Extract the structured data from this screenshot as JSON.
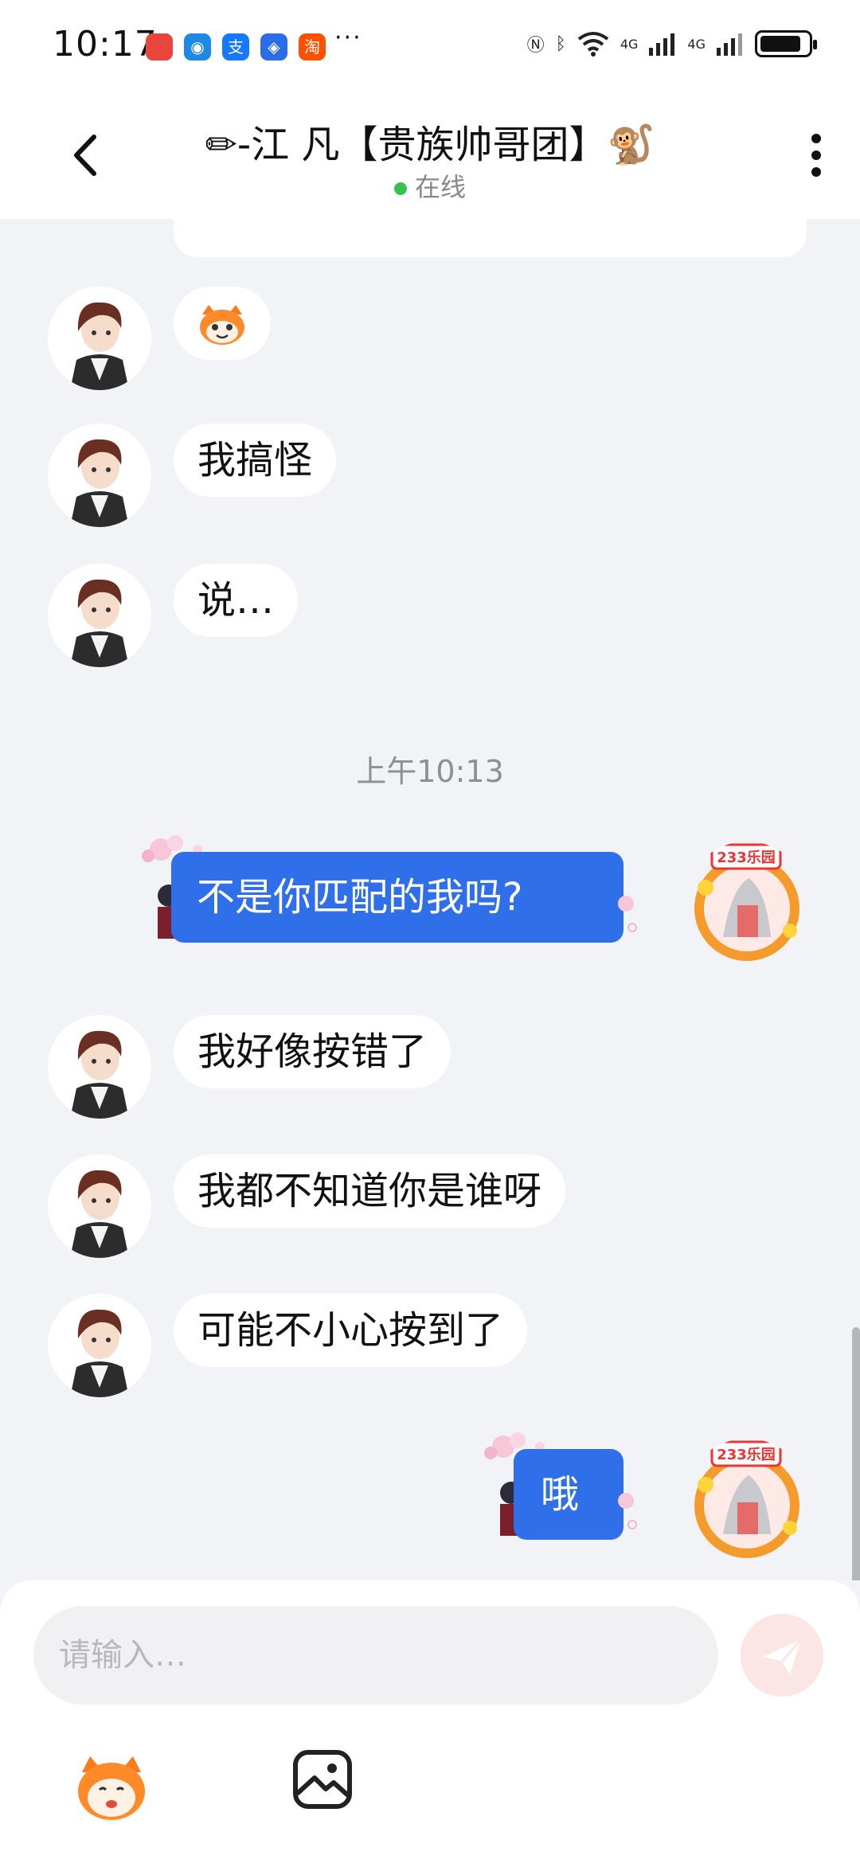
{
  "status_bar": {
    "time": "10:17",
    "more": "···",
    "network_1": "4G",
    "network_2": "4G",
    "app_icons": [
      "huawei-app-icon",
      "browser-icon",
      "alipay-icon",
      "app-store-icon",
      "taobao-icon"
    ]
  },
  "header": {
    "title": "✏-江 凡【贵族帅哥团】🐒",
    "status": "在线"
  },
  "messages": {
    "m2": "我搞怪",
    "m3": "说…",
    "timestamp": "上午10:13",
    "m4": "不是你匹配的我吗?",
    "m5": "我好像按错了",
    "m6": "我都不知道你是谁呀",
    "m7": "可能不小心按到了",
    "m8": "哦"
  },
  "input": {
    "placeholder": "请输入…"
  },
  "colors": {
    "outgoing_bubble": "#2f6fe9",
    "online_dot": "#36c24f",
    "send_button": "#fbe5e5"
  }
}
